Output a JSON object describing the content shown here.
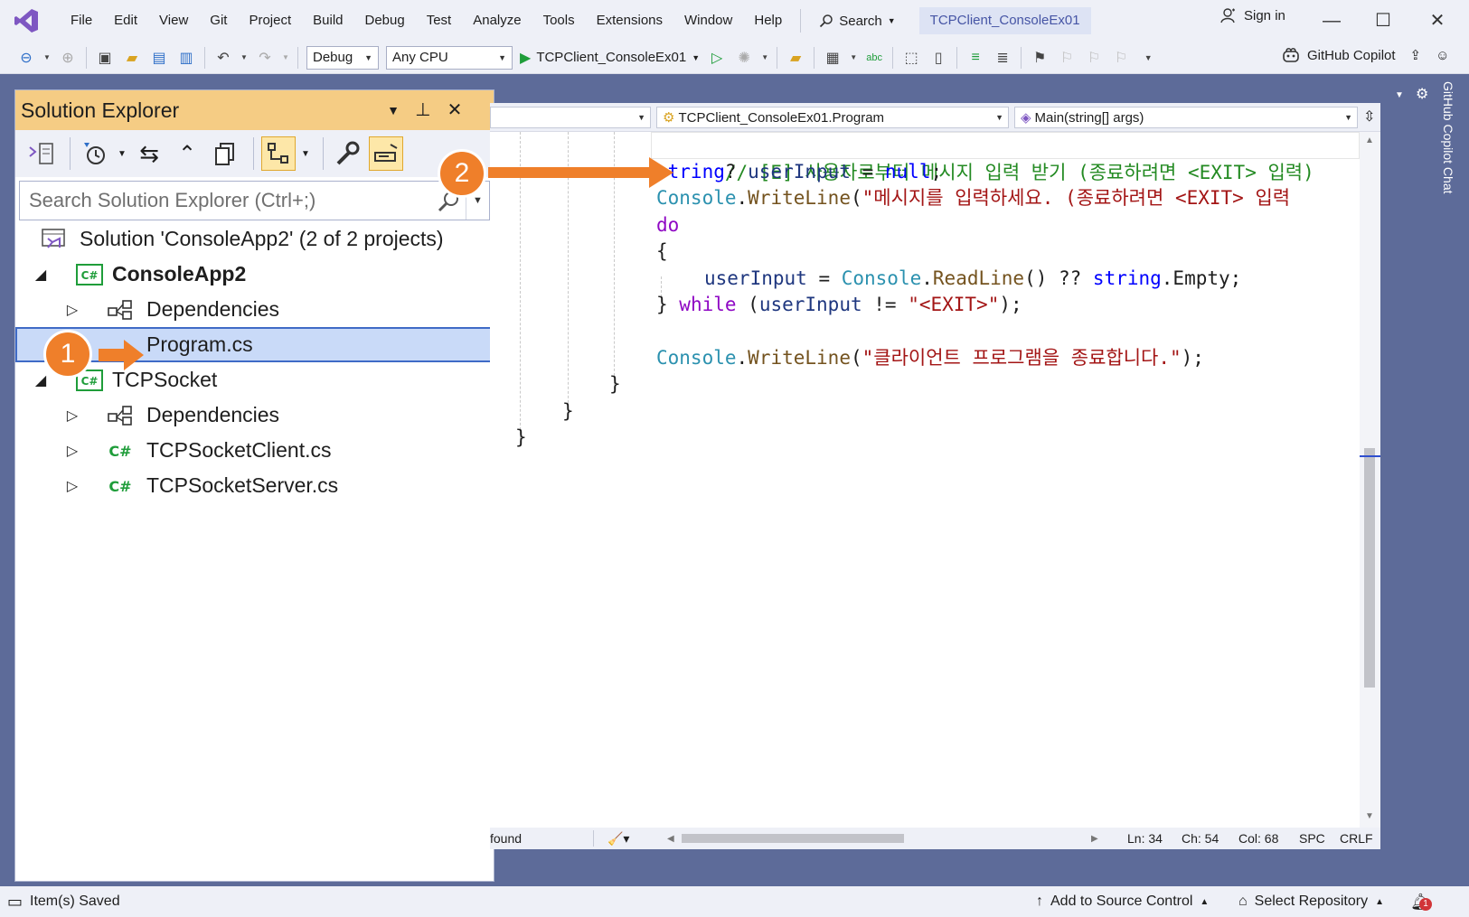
{
  "menu": {
    "items": [
      "File",
      "Edit",
      "View",
      "Git",
      "Project",
      "Build",
      "Debug",
      "Test",
      "Analyze",
      "Tools",
      "Extensions",
      "Window",
      "Help"
    ],
    "search_label": "Search",
    "title_tab": "TCPClient_ConsoleEx01",
    "sign_in": "Sign in"
  },
  "toolbar": {
    "configuration": "Debug",
    "platform": "Any CPU",
    "startup_project": "TCPClient_ConsoleEx01",
    "copilot_label": "GitHub Copilot"
  },
  "solution_explorer": {
    "title": "Solution Explorer",
    "search_placeholder": "Search Solution Explorer (Ctrl+;)",
    "tree": [
      {
        "label": "Solution 'ConsoleApp2' (2 of 2 projects)",
        "kind": "solution"
      },
      {
        "label": "ConsoleApp2",
        "kind": "project",
        "expanded": true,
        "bold": true
      },
      {
        "label": "Dependencies",
        "kind": "dependencies"
      },
      {
        "label": "Program.cs",
        "kind": "file",
        "selected": true
      },
      {
        "label": "TCPSocket",
        "kind": "project",
        "expanded": true
      },
      {
        "label": "Dependencies",
        "kind": "dependencies"
      },
      {
        "label": "TCPSocketClient.cs",
        "kind": "csharp"
      },
      {
        "label": "TCPSocketServer.cs",
        "kind": "csharp"
      }
    ]
  },
  "annotations": {
    "badge1": "1",
    "badge2": "2"
  },
  "editor": {
    "nav_class": "TCPClient_ConsoleEx01.Program",
    "nav_member": "Main(string[] args)",
    "code": {
      "l1_comment": "// [E] 사용자로부터 메시지 입력 받기 (종료하려면 <EXIT> 입력)",
      "l2_type": "string",
      "l2_rest_a": "? ",
      "l2_var": "userInput",
      "l2_eq": " = ",
      "l2_null": "null",
      "l2_end": ";",
      "l3_type": "Console",
      "l3_dot": ".",
      "l3_method": "WriteLine",
      "l3_open": "(",
      "l3_str": "\"메시지를 입력하세요. (종료하려면 <EXIT> 입력",
      "l4_do": "do",
      "l5_brace": "{",
      "l6_var": "userInput",
      "l6_eq": " = ",
      "l6_type": "Console",
      "l6_dot": ".",
      "l6_method": "ReadLine",
      "l6_call": "() ?? ",
      "l6_kw": "string",
      "l6_rest": ".Empty;",
      "l7_close": "} ",
      "l7_while": "while",
      "l7_open": " (",
      "l7_var": "userInput",
      "l7_neq": " != ",
      "l7_str": "\"<EXIT>\"",
      "l7_end": ");",
      "l9_type": "Console",
      "l9_dot": ".",
      "l9_method": "WriteLine",
      "l9_open": "(",
      "l9_str": "\"클라이언트 프로그램을 종료합니다.\"",
      "l9_end": ");",
      "l10_brace": "}",
      "l11_brace": "}",
      "l12_brace": "}"
    },
    "status": {
      "found": "found",
      "ln": "Ln: 34",
      "ch": "Ch: 54",
      "col": "Col: 68",
      "spc": "SPC",
      "crlf": "CRLF"
    }
  },
  "right_strip": {
    "label": "GitHub Copilot Chat"
  },
  "statusbar": {
    "message": "Item(s) Saved",
    "source_control": "Add to Source Control",
    "repository": "Select Repository",
    "notification_count": "1"
  },
  "colors": {
    "accent_orange": "#ef7f2a",
    "header_gold": "#f5cc84",
    "chrome_blue": "#5d6b99"
  }
}
